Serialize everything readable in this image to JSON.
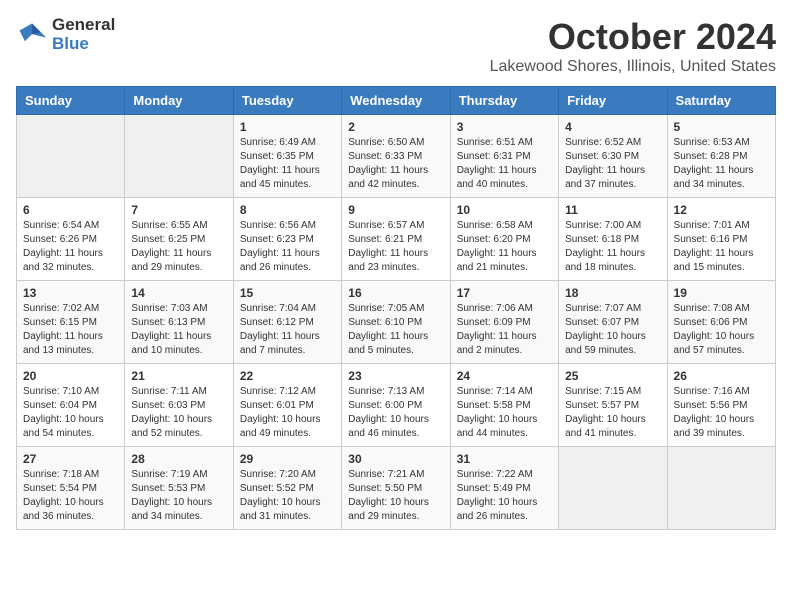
{
  "header": {
    "logo_line1": "General",
    "logo_line2": "Blue",
    "month": "October 2024",
    "location": "Lakewood Shores, Illinois, United States"
  },
  "days_of_week": [
    "Sunday",
    "Monday",
    "Tuesday",
    "Wednesday",
    "Thursday",
    "Friday",
    "Saturday"
  ],
  "weeks": [
    [
      {
        "day": "",
        "sunrise": "",
        "sunset": "",
        "daylight": ""
      },
      {
        "day": "",
        "sunrise": "",
        "sunset": "",
        "daylight": ""
      },
      {
        "day": "1",
        "sunrise": "Sunrise: 6:49 AM",
        "sunset": "Sunset: 6:35 PM",
        "daylight": "Daylight: 11 hours and 45 minutes."
      },
      {
        "day": "2",
        "sunrise": "Sunrise: 6:50 AM",
        "sunset": "Sunset: 6:33 PM",
        "daylight": "Daylight: 11 hours and 42 minutes."
      },
      {
        "day": "3",
        "sunrise": "Sunrise: 6:51 AM",
        "sunset": "Sunset: 6:31 PM",
        "daylight": "Daylight: 11 hours and 40 minutes."
      },
      {
        "day": "4",
        "sunrise": "Sunrise: 6:52 AM",
        "sunset": "Sunset: 6:30 PM",
        "daylight": "Daylight: 11 hours and 37 minutes."
      },
      {
        "day": "5",
        "sunrise": "Sunrise: 6:53 AM",
        "sunset": "Sunset: 6:28 PM",
        "daylight": "Daylight: 11 hours and 34 minutes."
      }
    ],
    [
      {
        "day": "6",
        "sunrise": "Sunrise: 6:54 AM",
        "sunset": "Sunset: 6:26 PM",
        "daylight": "Daylight: 11 hours and 32 minutes."
      },
      {
        "day": "7",
        "sunrise": "Sunrise: 6:55 AM",
        "sunset": "Sunset: 6:25 PM",
        "daylight": "Daylight: 11 hours and 29 minutes."
      },
      {
        "day": "8",
        "sunrise": "Sunrise: 6:56 AM",
        "sunset": "Sunset: 6:23 PM",
        "daylight": "Daylight: 11 hours and 26 minutes."
      },
      {
        "day": "9",
        "sunrise": "Sunrise: 6:57 AM",
        "sunset": "Sunset: 6:21 PM",
        "daylight": "Daylight: 11 hours and 23 minutes."
      },
      {
        "day": "10",
        "sunrise": "Sunrise: 6:58 AM",
        "sunset": "Sunset: 6:20 PM",
        "daylight": "Daylight: 11 hours and 21 minutes."
      },
      {
        "day": "11",
        "sunrise": "Sunrise: 7:00 AM",
        "sunset": "Sunset: 6:18 PM",
        "daylight": "Daylight: 11 hours and 18 minutes."
      },
      {
        "day": "12",
        "sunrise": "Sunrise: 7:01 AM",
        "sunset": "Sunset: 6:16 PM",
        "daylight": "Daylight: 11 hours and 15 minutes."
      }
    ],
    [
      {
        "day": "13",
        "sunrise": "Sunrise: 7:02 AM",
        "sunset": "Sunset: 6:15 PM",
        "daylight": "Daylight: 11 hours and 13 minutes."
      },
      {
        "day": "14",
        "sunrise": "Sunrise: 7:03 AM",
        "sunset": "Sunset: 6:13 PM",
        "daylight": "Daylight: 11 hours and 10 minutes."
      },
      {
        "day": "15",
        "sunrise": "Sunrise: 7:04 AM",
        "sunset": "Sunset: 6:12 PM",
        "daylight": "Daylight: 11 hours and 7 minutes."
      },
      {
        "day": "16",
        "sunrise": "Sunrise: 7:05 AM",
        "sunset": "Sunset: 6:10 PM",
        "daylight": "Daylight: 11 hours and 5 minutes."
      },
      {
        "day": "17",
        "sunrise": "Sunrise: 7:06 AM",
        "sunset": "Sunset: 6:09 PM",
        "daylight": "Daylight: 11 hours and 2 minutes."
      },
      {
        "day": "18",
        "sunrise": "Sunrise: 7:07 AM",
        "sunset": "Sunset: 6:07 PM",
        "daylight": "Daylight: 10 hours and 59 minutes."
      },
      {
        "day": "19",
        "sunrise": "Sunrise: 7:08 AM",
        "sunset": "Sunset: 6:06 PM",
        "daylight": "Daylight: 10 hours and 57 minutes."
      }
    ],
    [
      {
        "day": "20",
        "sunrise": "Sunrise: 7:10 AM",
        "sunset": "Sunset: 6:04 PM",
        "daylight": "Daylight: 10 hours and 54 minutes."
      },
      {
        "day": "21",
        "sunrise": "Sunrise: 7:11 AM",
        "sunset": "Sunset: 6:03 PM",
        "daylight": "Daylight: 10 hours and 52 minutes."
      },
      {
        "day": "22",
        "sunrise": "Sunrise: 7:12 AM",
        "sunset": "Sunset: 6:01 PM",
        "daylight": "Daylight: 10 hours and 49 minutes."
      },
      {
        "day": "23",
        "sunrise": "Sunrise: 7:13 AM",
        "sunset": "Sunset: 6:00 PM",
        "daylight": "Daylight: 10 hours and 46 minutes."
      },
      {
        "day": "24",
        "sunrise": "Sunrise: 7:14 AM",
        "sunset": "Sunset: 5:58 PM",
        "daylight": "Daylight: 10 hours and 44 minutes."
      },
      {
        "day": "25",
        "sunrise": "Sunrise: 7:15 AM",
        "sunset": "Sunset: 5:57 PM",
        "daylight": "Daylight: 10 hours and 41 minutes."
      },
      {
        "day": "26",
        "sunrise": "Sunrise: 7:16 AM",
        "sunset": "Sunset: 5:56 PM",
        "daylight": "Daylight: 10 hours and 39 minutes."
      }
    ],
    [
      {
        "day": "27",
        "sunrise": "Sunrise: 7:18 AM",
        "sunset": "Sunset: 5:54 PM",
        "daylight": "Daylight: 10 hours and 36 minutes."
      },
      {
        "day": "28",
        "sunrise": "Sunrise: 7:19 AM",
        "sunset": "Sunset: 5:53 PM",
        "daylight": "Daylight: 10 hours and 34 minutes."
      },
      {
        "day": "29",
        "sunrise": "Sunrise: 7:20 AM",
        "sunset": "Sunset: 5:52 PM",
        "daylight": "Daylight: 10 hours and 31 minutes."
      },
      {
        "day": "30",
        "sunrise": "Sunrise: 7:21 AM",
        "sunset": "Sunset: 5:50 PM",
        "daylight": "Daylight: 10 hours and 29 minutes."
      },
      {
        "day": "31",
        "sunrise": "Sunrise: 7:22 AM",
        "sunset": "Sunset: 5:49 PM",
        "daylight": "Daylight: 10 hours and 26 minutes."
      },
      {
        "day": "",
        "sunrise": "",
        "sunset": "",
        "daylight": ""
      },
      {
        "day": "",
        "sunrise": "",
        "sunset": "",
        "daylight": ""
      }
    ]
  ]
}
